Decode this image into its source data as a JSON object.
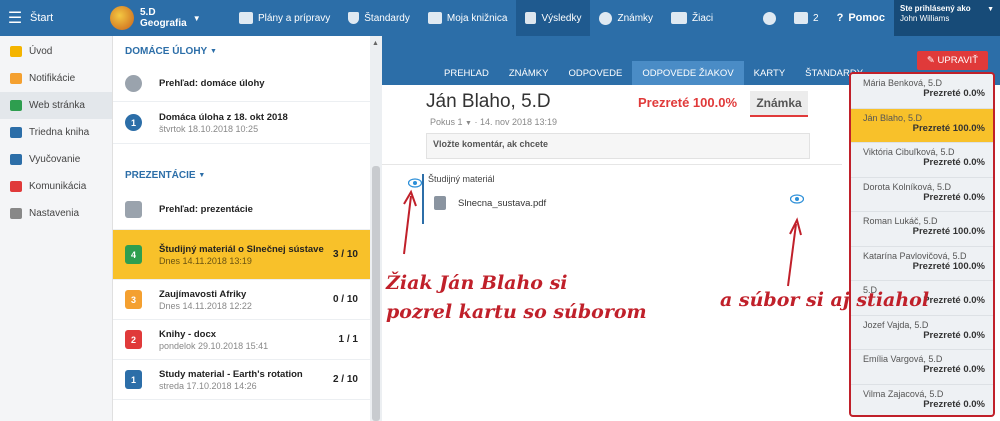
{
  "topbar": {
    "start_label": "Štart",
    "class_name": "5.D",
    "class_subject": "Geografia",
    "nav": [
      {
        "label": "Plány a prípravy",
        "icon": "book-icon"
      },
      {
        "label": "Štandardy",
        "icon": "shield-icon"
      },
      {
        "label": "Moja knižnica",
        "icon": "library-icon"
      },
      {
        "label": "Výsledky",
        "icon": "bar-chart-icon",
        "active": true
      },
      {
        "label": "Známky",
        "icon": "grade-icon"
      },
      {
        "label": "Žiaci",
        "icon": "students-icon"
      }
    ],
    "messages_count": "2",
    "help_label": "Pomoc",
    "user_line1": "Ste prihlásený ako",
    "user_line2": "John Williams"
  },
  "sidebar": {
    "items": [
      {
        "label": "Úvod",
        "icon": "star-icon",
        "color": "#f4b400"
      },
      {
        "label": "Notifikácie",
        "icon": "mail-icon",
        "color": "#f4a030"
      },
      {
        "label": "Web stránka",
        "icon": "home-icon",
        "color": "#2e9e4f"
      },
      {
        "label": "Triedna kniha",
        "icon": "book-icon",
        "color": "#2c6ea8"
      },
      {
        "label": "Vyučovanie",
        "icon": "teaching-icon",
        "color": "#2c6ea8"
      },
      {
        "label": "Komunikácia",
        "icon": "chat-icon",
        "color": "#e03a3a"
      },
      {
        "label": "Nastavenia",
        "icon": "gear-icon",
        "color": "#888888"
      }
    ]
  },
  "homework": {
    "header": "DOMÁCE ÚLOHY",
    "overview": "Prehľad: domáce úlohy",
    "item_title": "Domáca úloha z 18. okt 2018",
    "item_sub": "štvrtok 18.10.2018 10:25",
    "item_num": "1"
  },
  "presentations": {
    "header": "PREZENTÁCIE",
    "overview": "Prehľad: prezentácie",
    "items": [
      {
        "num": "4",
        "color": "#2e9e4f",
        "title": "Študijný materiál o Slnečnej sústave",
        "sub": "Dnes 14.11.2018 13:19",
        "count": "3 / 10"
      },
      {
        "num": "3",
        "color": "#f4a030",
        "title": "Zaujímavosti Afriky",
        "sub": "Dnes 14.11.2018 12:22",
        "count": "0 / 10"
      },
      {
        "num": "2",
        "color": "#e03a3a",
        "title": "Knihy - docx",
        "sub": "pondelok 29.10.2018 15:41",
        "count": "1 / 1"
      },
      {
        "num": "1",
        "color": "#2c6ea8",
        "title": "Study material - Earth's rotation",
        "sub": "streda 17.10.2018 14:26",
        "count": "2 / 10"
      }
    ]
  },
  "tabs": [
    "PREHĽAD",
    "ZNÁMKY",
    "ODPOVEDE",
    "ODPOVEDE ŽIAKOV",
    "KARTY",
    "ŠTANDARDY"
  ],
  "upravit_label": "UPRAVIŤ",
  "detail": {
    "student": "Ján Blaho, 5.D",
    "attempt": "Pokus 1",
    "date": "14. nov 2018 13:19",
    "viewed": "Prezreté 100.0%",
    "grade_label": "Známka",
    "comment_placeholder": "Vložte komentár, ak chcete",
    "material_label": "Študijný materiál",
    "file_name": "Slnecna_sustava.pdf"
  },
  "students": [
    {
      "name": "Mária Benková, 5.D",
      "viewed": "Prezreté 0.0%"
    },
    {
      "name": "Ján Blaho, 5.D",
      "viewed": "Prezreté 100.0%",
      "selected": true
    },
    {
      "name": "Viktória Cibuľková, 5.D",
      "viewed": "Prezreté 0.0%"
    },
    {
      "name": "Dorota Kolníková, 5.D",
      "viewed": "Prezreté 0.0%"
    },
    {
      "name": "Roman Lukáč, 5.D",
      "viewed": "Prezreté 100.0%"
    },
    {
      "name": "Katarína Pavlovičová, 5.D",
      "viewed": "Prezreté 100.0%"
    },
    {
      "name": "5.D",
      "viewed": "Prezreté 0.0%"
    },
    {
      "name": "Jozef Vajda, 5.D",
      "viewed": "Prezreté 0.0%"
    },
    {
      "name": "Emília Vargová, 5.D",
      "viewed": "Prezreté 0.0%"
    },
    {
      "name": "Vilma Zajacová, 5.D",
      "viewed": "Prezreté 0.0%"
    }
  ],
  "annotations": {
    "left_line1": "Žiak Ján Blaho si",
    "left_line2": "pozrel kartu so súborom",
    "right": "a súbor si aj stiahol"
  }
}
